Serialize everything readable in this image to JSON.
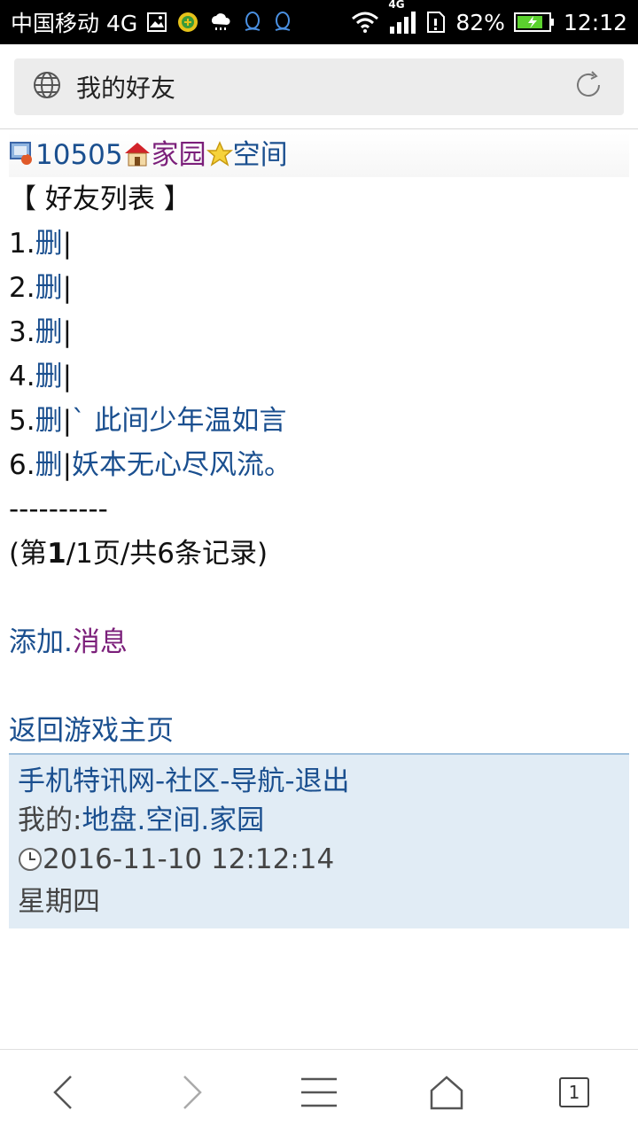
{
  "status_bar": {
    "carrier": "中国移动 4G",
    "network": "4G",
    "battery": "82%",
    "time": "12:12",
    "icons": [
      "image-icon",
      "coin-icon",
      "weather-icon",
      "qq-icon",
      "qq-icon",
      "wifi-icon",
      "signal-icon",
      "sim-icon",
      "battery-icon"
    ]
  },
  "address_bar": {
    "title": "我的好友",
    "icons": [
      "globe-icon",
      "refresh-icon"
    ]
  },
  "header": {
    "user_id": "10505",
    "home_link": "家园",
    "space_link": "空间",
    "icons": [
      "user-icon",
      "house-icon",
      "star-icon"
    ]
  },
  "friends": {
    "heading": "【 好友列表 】",
    "items": [
      {
        "num": "1.",
        "delete": "删",
        "sep": "|",
        "name": ""
      },
      {
        "num": "2.",
        "delete": "删",
        "sep": "|",
        "name": ""
      },
      {
        "num": "3.",
        "delete": "删",
        "sep": "|",
        "name": ""
      },
      {
        "num": "4.",
        "delete": "删",
        "sep": "|",
        "name": ""
      },
      {
        "num": "5.",
        "delete": "删",
        "sep": "|",
        "name": "ˋ 此间少年温如言"
      },
      {
        "num": "6.",
        "delete": "删",
        "sep": "|",
        "name": "妖本无心尽风流。"
      }
    ],
    "divider": "----------",
    "pagination": {
      "prefix": "(第",
      "current": "1",
      "suffix": "/1页/共6条记录)"
    }
  },
  "actions": {
    "add": "添加",
    "dot": ".",
    "messages": "消息",
    "back_home": "返回游戏主页"
  },
  "footer": {
    "links": [
      "手机特讯网",
      "社区",
      "导航",
      "退出"
    ],
    "sep": "-",
    "mine_label": "我的:",
    "mine_links": [
      "地盘",
      "空间",
      "家园"
    ],
    "dot": ".",
    "datetime": "2016-11-10 12:12:14",
    "weekday": "星期四"
  },
  "bottom_nav": {
    "tab_count": "1",
    "icons": [
      "back-icon",
      "forward-icon",
      "menu-icon",
      "home-icon",
      "tabs-icon"
    ]
  },
  "colors": {
    "link_blue": "#1a4f8f",
    "link_purple": "#7b1f7a",
    "footer_bg": "#e1ecf5"
  }
}
